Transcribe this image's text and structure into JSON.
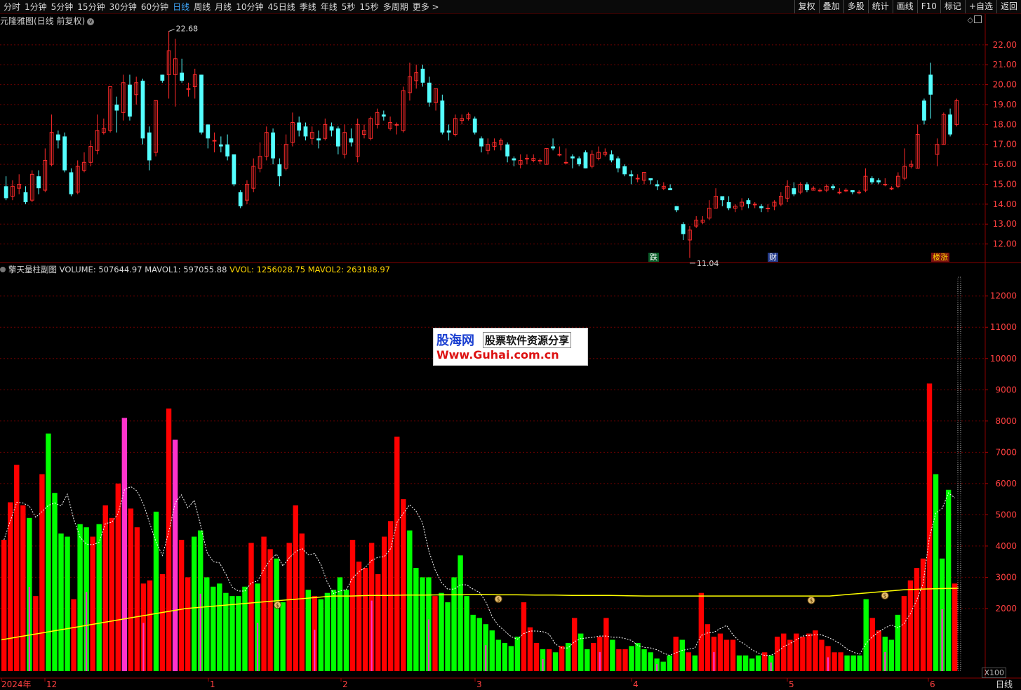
{
  "toolbar": {
    "periods": [
      "分时",
      "1分钟",
      "5分钟",
      "15分钟",
      "30分钟",
      "60分钟",
      "日线",
      "周线",
      "月线",
      "10分钟",
      "45日线",
      "季线",
      "年线",
      "5秒",
      "15秒",
      "多周期",
      "更多 >"
    ],
    "active_period": "日线",
    "actions": [
      "复权",
      "叠加",
      "多股",
      "统计",
      "画线",
      "F10",
      "标记",
      "+自选",
      "返回"
    ]
  },
  "main_chart": {
    "title": "元隆雅图(日线 前复权)",
    "high_label": "22.68",
    "low_label": "11.04",
    "price_ticks": [
      "22.00",
      "21.00",
      "20.00",
      "19.00",
      "18.00",
      "17.00",
      "16.00",
      "15.00",
      "14.00",
      "13.00",
      "12.00"
    ],
    "event_tags": [
      "跌",
      "财",
      "楼涨"
    ]
  },
  "sub_chart": {
    "title": "擎天量柱副图",
    "volume": "VOLUME: 507644.97",
    "mavol1": "MAVOL1: 597055.88",
    "vvol": "VVOL: 1256028.75",
    "mavol2": "MAVOL2: 263188.97",
    "volume_ticks": [
      "12000",
      "11000",
      "10000",
      "9000",
      "8000",
      "7000",
      "6000",
      "5000",
      "4000",
      "3000",
      "2000"
    ],
    "unit": "X100",
    "marker_icon": "money-bag-icon"
  },
  "x_axis": {
    "labels": [
      "2024年",
      "12",
      "1",
      "2",
      "3",
      "4",
      "5",
      "6"
    ]
  },
  "period_label": "日线",
  "watermark": {
    "line1a": "股海网",
    "line1b": "股票软件资源分享",
    "line2": "Www.Guhai.com.cn"
  },
  "colors": {
    "up": "#ff2a2a",
    "down": "#54ffff",
    "vol_up": "#ff0000",
    "vol_down": "#00ff00",
    "vol_special": "#ff33cc",
    "ma_line": "#ffff00",
    "grid": "#6e0000"
  },
  "chart_data": {
    "type": "candlestick",
    "price_range": [
      11.0,
      22.7
    ],
    "volume_range_x100": [
      0,
      12600
    ],
    "candles": [
      [
        14.9,
        14.3,
        15.4,
        14.2
      ],
      [
        14.4,
        14.9,
        15.2,
        14.2
      ],
      [
        14.8,
        15.0,
        15.5,
        14.5
      ],
      [
        14.6,
        14.1,
        14.9,
        14.0
      ],
      [
        14.2,
        15.5,
        15.7,
        14.1
      ],
      [
        15.4,
        14.8,
        15.7,
        14.5
      ],
      [
        14.7,
        16.2,
        16.8,
        14.6
      ],
      [
        16.0,
        17.6,
        18.5,
        15.9
      ],
      [
        17.5,
        17.2,
        17.7,
        16.8
      ],
      [
        17.4,
        15.7,
        17.6,
        15.6
      ],
      [
        15.6,
        14.5,
        15.8,
        14.4
      ],
      [
        14.6,
        15.9,
        16.2,
        14.5
      ],
      [
        15.7,
        16.1,
        16.6,
        15.6
      ],
      [
        16.1,
        16.9,
        17.2,
        15.9
      ],
      [
        16.7,
        17.7,
        18.5,
        16.5
      ],
      [
        17.6,
        17.8,
        18.3,
        17.5
      ],
      [
        17.7,
        19.9,
        19.8,
        17.6
      ],
      [
        19.0,
        18.7,
        19.4,
        17.6
      ],
      [
        18.6,
        20.1,
        20.5,
        18.2
      ],
      [
        20.0,
        18.4,
        20.5,
        18.2
      ],
      [
        19.5,
        20.1,
        20.4,
        19.0
      ],
      [
        20.2,
        17.3,
        20.3,
        17.0
      ],
      [
        17.6,
        16.2,
        17.9,
        15.7
      ],
      [
        16.6,
        19.2,
        19.2,
        16.4
      ],
      [
        20.5,
        20.2,
        20.5,
        20.1
      ],
      [
        20.5,
        21.7,
        22.7,
        19.3
      ],
      [
        20.5,
        21.3,
        22.3,
        18.9
      ],
      [
        20.6,
        20.2,
        21.3,
        20.1
      ],
      [
        19.8,
        19.8,
        20.1,
        19.4
      ],
      [
        19.9,
        20.5,
        20.8,
        19.3
      ],
      [
        20.5,
        17.6,
        20.5,
        17.5
      ],
      [
        18.0,
        17.3,
        18.0,
        16.8
      ],
      [
        17.2,
        17.2,
        17.6,
        16.6
      ],
      [
        17.0,
        16.9,
        17.4,
        16.6
      ],
      [
        17.0,
        16.4,
        17.5,
        16.2
      ],
      [
        16.5,
        15.0,
        16.5,
        14.9
      ],
      [
        14.6,
        13.9,
        14.7,
        13.8
      ],
      [
        14.2,
        15.0,
        15.2,
        14.0
      ],
      [
        14.8,
        15.9,
        16.3,
        14.6
      ],
      [
        15.8,
        16.4,
        17.1,
        15.6
      ],
      [
        16.4,
        17.6,
        17.9,
        16.2
      ],
      [
        17.6,
        16.3,
        17.8,
        16.0
      ],
      [
        16.0,
        15.4,
        16.3,
        14.9
      ],
      [
        15.8,
        17.0,
        17.5,
        15.7
      ],
      [
        17.1,
        18.1,
        18.6,
        16.9
      ],
      [
        18.1,
        17.7,
        18.4,
        17.4
      ],
      [
        17.9,
        17.4,
        18.1,
        17.2
      ],
      [
        17.3,
        17.6,
        17.9,
        17.0
      ],
      [
        17.3,
        17.2,
        17.7,
        16.8
      ],
      [
        17.3,
        18.0,
        18.3,
        17.2
      ],
      [
        17.9,
        17.7,
        18.1,
        17.4
      ],
      [
        17.8,
        16.9,
        17.9,
        16.5
      ],
      [
        16.5,
        17.6,
        18.0,
        16.3
      ],
      [
        17.3,
        17.1,
        17.8,
        16.9
      ],
      [
        16.4,
        18.0,
        18.3,
        16.1
      ],
      [
        17.5,
        17.7,
        18.0,
        17.3
      ],
      [
        17.3,
        18.3,
        18.4,
        17.2
      ],
      [
        18.0,
        18.6,
        18.8,
        17.8
      ],
      [
        18.5,
        18.4,
        18.7,
        18.2
      ],
      [
        17.8,
        18.1,
        18.4,
        17.7
      ],
      [
        18.0,
        18.0,
        18.1,
        17.5
      ],
      [
        17.7,
        19.7,
        19.9,
        17.6
      ],
      [
        19.6,
        20.4,
        21.1,
        19.2
      ],
      [
        20.2,
        20.6,
        21.0,
        19.8
      ],
      [
        20.8,
        20.1,
        21.0,
        19.9
      ],
      [
        20.1,
        19.1,
        20.4,
        18.9
      ],
      [
        19.1,
        19.8,
        19.8,
        18.7
      ],
      [
        19.2,
        17.6,
        19.5,
        17.5
      ],
      [
        17.7,
        17.6,
        18.0,
        17.2
      ],
      [
        17.5,
        18.3,
        18.5,
        17.4
      ],
      [
        18.2,
        18.3,
        18.5,
        18.0
      ],
      [
        18.3,
        18.5,
        18.6,
        18.2
      ],
      [
        18.3,
        17.6,
        18.4,
        17.5
      ],
      [
        17.3,
        16.9,
        17.4,
        16.6
      ],
      [
        16.7,
        17.0,
        17.3,
        16.5
      ],
      [
        16.9,
        17.1,
        17.3,
        16.7
      ],
      [
        17.0,
        17.2,
        17.3,
        16.7
      ],
      [
        17.0,
        16.4,
        17.1,
        16.1
      ],
      [
        16.3,
        16.2,
        16.4,
        15.9
      ],
      [
        16.0,
        16.2,
        16.5,
        15.8
      ],
      [
        16.3,
        16.3,
        16.5,
        16.0
      ],
      [
        16.2,
        16.3,
        16.5,
        16.1
      ],
      [
        16.2,
        16.2,
        16.3,
        16.0
      ],
      [
        16.0,
        16.8,
        16.8,
        16.0
      ],
      [
        16.9,
        16.8,
        17.3,
        16.7
      ],
      [
        16.5,
        16.5,
        16.9,
        16.4
      ],
      [
        16.1,
        16.1,
        16.8,
        16.0
      ],
      [
        16.4,
        16.3,
        16.5,
        15.8
      ],
      [
        16.3,
        16.0,
        16.4,
        15.9
      ],
      [
        16.6,
        15.8,
        16.7,
        15.8
      ],
      [
        15.9,
        16.5,
        16.7,
        15.8
      ],
      [
        16.3,
        16.6,
        16.9,
        16.2
      ],
      [
        16.5,
        16.6,
        16.8,
        16.4
      ],
      [
        16.5,
        16.2,
        16.7,
        16.1
      ],
      [
        16.3,
        15.8,
        16.4,
        15.6
      ],
      [
        15.9,
        15.5,
        16.0,
        15.4
      ],
      [
        15.5,
        15.4,
        15.7,
        15.0
      ],
      [
        15.3,
        15.3,
        15.5,
        15.1
      ],
      [
        15.2,
        15.6,
        15.6,
        15.0
      ],
      [
        15.3,
        15.2,
        15.3,
        15.0
      ],
      [
        15.0,
        14.9,
        15.2,
        14.7
      ],
      [
        14.8,
        14.9,
        15.1,
        14.7
      ],
      [
        14.8,
        14.7,
        15.0,
        14.7
      ],
      [
        13.9,
        13.7,
        13.9,
        13.6
      ],
      [
        13.0,
        12.5,
        13.1,
        12.2
      ],
      [
        12.2,
        12.7,
        12.9,
        11.3
      ],
      [
        12.9,
        13.2,
        13.4,
        12.8
      ],
      [
        13.1,
        13.2,
        13.4,
        13.0
      ],
      [
        13.3,
        13.8,
        14.2,
        13.2
      ],
      [
        13.8,
        14.4,
        14.8,
        13.8
      ],
      [
        14.4,
        14.2,
        14.3,
        13.9
      ],
      [
        14.1,
        13.8,
        14.4,
        13.7
      ],
      [
        13.8,
        13.9,
        14.0,
        13.6
      ],
      [
        13.9,
        14.1,
        14.3,
        13.7
      ],
      [
        14.2,
        14.0,
        14.3,
        13.8
      ],
      [
        14.0,
        14.0,
        14.1,
        13.8
      ],
      [
        13.9,
        13.8,
        14.0,
        13.6
      ],
      [
        13.8,
        13.8,
        14.0,
        13.6
      ],
      [
        13.9,
        14.1,
        14.2,
        13.7
      ],
      [
        14.0,
        14.4,
        14.6,
        13.9
      ],
      [
        14.3,
        14.9,
        15.2,
        14.1
      ],
      [
        14.8,
        14.5,
        15.1,
        14.4
      ],
      [
        14.6,
        15.0,
        15.1,
        14.5
      ],
      [
        15.0,
        14.7,
        15.1,
        14.6
      ],
      [
        14.7,
        14.8,
        14.9,
        14.7
      ],
      [
        14.7,
        14.7,
        14.8,
        14.6
      ],
      [
        14.7,
        14.9,
        15.0,
        14.6
      ],
      [
        14.9,
        14.8,
        15.0,
        14.7
      ],
      [
        14.6,
        14.6,
        14.8,
        14.5
      ],
      [
        14.7,
        14.7,
        14.8,
        14.6
      ],
      [
        14.7,
        14.6,
        14.7,
        14.5
      ],
      [
        14.6,
        14.6,
        14.7,
        14.5
      ],
      [
        14.7,
        15.4,
        15.8,
        14.6
      ],
      [
        15.3,
        15.1,
        15.4,
        15.0
      ],
      [
        15.2,
        15.1,
        15.3,
        15.0
      ],
      [
        15.0,
        15.0,
        15.3,
        14.9
      ],
      [
        14.8,
        14.8,
        14.9,
        14.7
      ],
      [
        14.9,
        15.4,
        15.6,
        14.8
      ],
      [
        15.3,
        15.9,
        16.8,
        15.2
      ],
      [
        15.9,
        16.0,
        16.2,
        15.8
      ],
      [
        15.8,
        17.5,
        18.0,
        15.8
      ],
      [
        19.2,
        18.2,
        19.3,
        18.0
      ],
      [
        20.5,
        19.5,
        21.1,
        18.3
      ],
      [
        16.5,
        17.0,
        17.3,
        15.9
      ],
      [
        17.0,
        18.5,
        18.6,
        17.0
      ],
      [
        18.5,
        17.5,
        18.8,
        17.4
      ],
      [
        18.0,
        19.2,
        19.3,
        17.9
      ]
    ],
    "volumes_x100": [
      [
        4200,
        "r"
      ],
      [
        5400,
        "r"
      ],
      [
        6600,
        "r"
      ],
      [
        5300,
        "r"
      ],
      [
        4900,
        "g"
      ],
      [
        2400,
        "r"
      ],
      [
        6300,
        "r"
      ],
      [
        7600,
        "g"
      ],
      [
        5700,
        "g"
      ],
      [
        4400,
        "g"
      ],
      [
        4300,
        "g"
      ],
      [
        2300,
        "r"
      ],
      [
        4700,
        "g"
      ],
      [
        4600,
        "g"
      ],
      [
        4300,
        "r"
      ],
      [
        4700,
        "g"
      ],
      [
        5300,
        "r"
      ],
      [
        4900,
        "r"
      ],
      [
        6000,
        "r"
      ],
      [
        8100,
        "m"
      ],
      [
        5200,
        "r"
      ],
      [
        4600,
        "r"
      ],
      [
        2800,
        "r"
      ],
      [
        2900,
        "r"
      ],
      [
        5100,
        "g"
      ],
      [
        3100,
        "r"
      ],
      [
        8400,
        "r"
      ],
      [
        7400,
        "m"
      ],
      [
        4200,
        "r"
      ],
      [
        3000,
        "r"
      ],
      [
        4300,
        "g"
      ],
      [
        4500,
        "g"
      ],
      [
        3000,
        "g"
      ],
      [
        2700,
        "g"
      ],
      [
        2800,
        "g"
      ],
      [
        2500,
        "g"
      ],
      [
        2400,
        "g"
      ],
      [
        2400,
        "g"
      ],
      [
        2700,
        "g"
      ],
      [
        4100,
        "r"
      ],
      [
        2800,
        "g"
      ],
      [
        4300,
        "r"
      ],
      [
        3900,
        "r"
      ],
      [
        3600,
        "g"
      ],
      [
        2200,
        "g"
      ],
      [
        4100,
        "r"
      ],
      [
        5300,
        "r"
      ],
      [
        4400,
        "r"
      ],
      [
        2600,
        "g"
      ],
      [
        2400,
        "r"
      ],
      [
        2300,
        "g"
      ],
      [
        2500,
        "g"
      ],
      [
        2600,
        "g"
      ],
      [
        3000,
        "g"
      ],
      [
        2600,
        "g"
      ],
      [
        4200,
        "r"
      ],
      [
        3500,
        "r"
      ],
      [
        3300,
        "r"
      ],
      [
        4100,
        "r"
      ],
      [
        3100,
        "r"
      ],
      [
        4300,
        "r"
      ],
      [
        4800,
        "r"
      ],
      [
        7500,
        "r"
      ],
      [
        5500,
        "r"
      ],
      [
        4500,
        "g"
      ],
      [
        3300,
        "g"
      ],
      [
        3000,
        "g"
      ],
      [
        3000,
        "g"
      ],
      [
        2400,
        "r"
      ],
      [
        2500,
        "g"
      ],
      [
        2200,
        "g"
      ],
      [
        3000,
        "g"
      ],
      [
        3700,
        "g"
      ],
      [
        2400,
        "g"
      ],
      [
        1800,
        "g"
      ],
      [
        1700,
        "g"
      ],
      [
        1500,
        "g"
      ],
      [
        1300,
        "g"
      ],
      [
        1000,
        "g"
      ],
      [
        900,
        "g"
      ],
      [
        800,
        "g"
      ],
      [
        1100,
        "g"
      ],
      [
        2200,
        "r"
      ],
      [
        1400,
        "r"
      ],
      [
        900,
        "r"
      ],
      [
        700,
        "g"
      ],
      [
        700,
        "r"
      ],
      [
        600,
        "g"
      ],
      [
        800,
        "r"
      ],
      [
        900,
        "g"
      ],
      [
        1700,
        "r"
      ],
      [
        1200,
        "g"
      ],
      [
        700,
        "g"
      ],
      [
        900,
        "r"
      ],
      [
        1100,
        "r"
      ],
      [
        1700,
        "r"
      ],
      [
        1000,
        "g"
      ],
      [
        700,
        "r"
      ],
      [
        700,
        "r"
      ],
      [
        800,
        "g"
      ],
      [
        900,
        "g"
      ],
      [
        700,
        "g"
      ],
      [
        600,
        "g"
      ],
      [
        400,
        "g"
      ],
      [
        300,
        "g"
      ],
      [
        500,
        "g"
      ],
      [
        1100,
        "r"
      ],
      [
        1000,
        "g"
      ],
      [
        600,
        "r"
      ],
      [
        500,
        "g"
      ],
      [
        2500,
        "r"
      ],
      [
        1500,
        "r"
      ],
      [
        1100,
        "r"
      ],
      [
        1200,
        "r"
      ],
      [
        1000,
        "r"
      ],
      [
        1000,
        "r"
      ],
      [
        500,
        "g"
      ],
      [
        500,
        "g"
      ],
      [
        400,
        "g"
      ],
      [
        500,
        "g"
      ],
      [
        600,
        "r"
      ],
      [
        500,
        "g"
      ],
      [
        1100,
        "r"
      ],
      [
        1200,
        "r"
      ],
      [
        1000,
        "r"
      ],
      [
        1200,
        "r"
      ],
      [
        1100,
        "r"
      ],
      [
        1200,
        "r"
      ],
      [
        1300,
        "r"
      ],
      [
        1000,
        "r"
      ],
      [
        800,
        "r"
      ],
      [
        600,
        "r"
      ],
      [
        600,
        "r"
      ],
      [
        500,
        "g"
      ],
      [
        500,
        "g"
      ],
      [
        500,
        "g"
      ],
      [
        2300,
        "g"
      ],
      [
        1700,
        "r"
      ],
      [
        1300,
        "r"
      ],
      [
        1100,
        "g"
      ],
      [
        1000,
        "g"
      ],
      [
        1800,
        "g"
      ],
      [
        2400,
        "r"
      ],
      [
        2900,
        "r"
      ],
      [
        3300,
        "r"
      ],
      [
        3600,
        "r"
      ],
      [
        9200,
        "r"
      ],
      [
        6300,
        "g"
      ],
      [
        3600,
        "g"
      ],
      [
        5800,
        "g"
      ],
      [
        2800,
        "r"
      ]
    ],
    "mavol_line_x100": [
      1000,
      1100,
      1200,
      1300,
      1400,
      1500,
      1600,
      1700,
      1800,
      1900,
      2000,
      2050,
      2100,
      2150,
      2200,
      2250,
      2300,
      2350,
      2400,
      2400,
      2420,
      2420,
      2430,
      2430,
      2440,
      2440,
      2450,
      2440,
      2440,
      2430,
      2430,
      2420,
      2420,
      2420,
      2410,
      2400,
      2400,
      2400,
      2400,
      2400,
      2400,
      2400,
      2400,
      2400,
      2400,
      2400,
      2450,
      2500,
      2550,
      2600,
      2620,
      2640,
      2650
    ]
  }
}
